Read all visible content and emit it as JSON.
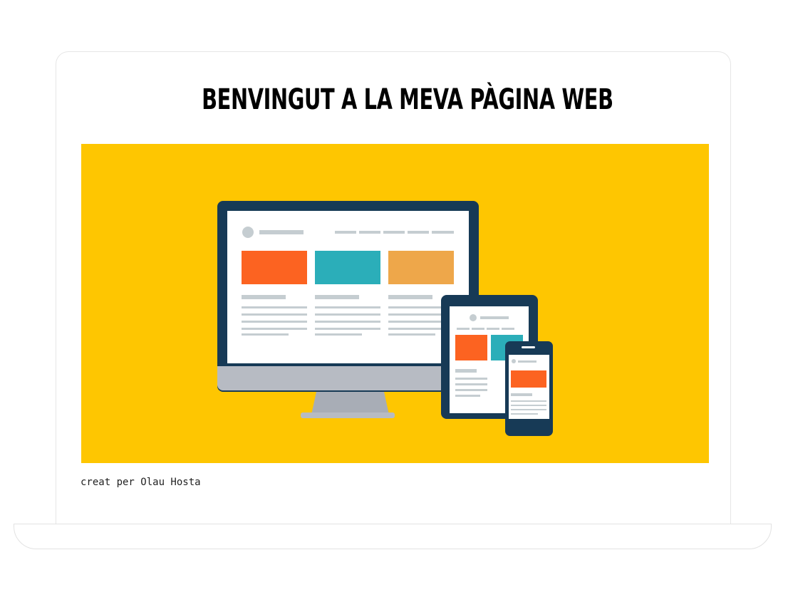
{
  "page": {
    "title": "BENVINGUT A LA MEVA PÀGINA WEB",
    "credit": "creat per Olau Hosta"
  },
  "hero_image": {
    "depicts": "responsive-devices-illustration",
    "colors": {
      "background": "#FEC601",
      "device_frame": "#173A56",
      "screen": "#FFFFFF",
      "monitor_stand": "#A8ADB6",
      "monitor_chin": "#B7BBC3",
      "placeholder_lines": "#C5CDD1",
      "card_orange": "#FC6321",
      "card_teal": "#2BAEB9",
      "card_amber": "#EEA74A"
    }
  }
}
